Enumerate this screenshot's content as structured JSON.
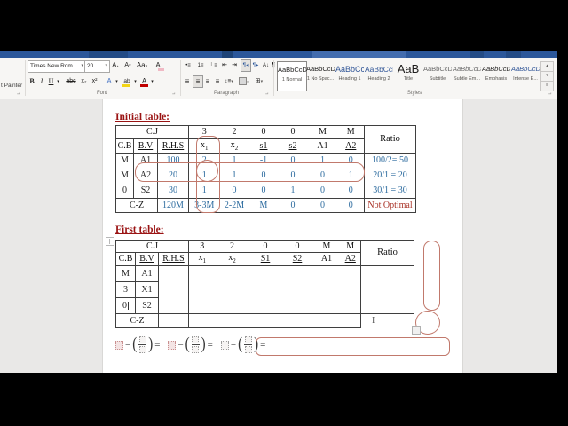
{
  "ribbon": {
    "clipboard": {
      "painter_label": "t Painter"
    },
    "font_group": {
      "label": "Font",
      "font_name": "Times New Rom",
      "font_size": "20"
    },
    "paragraph_group": {
      "label": "Paragraph"
    },
    "styles_group": {
      "label": "Styles",
      "items": [
        {
          "sample": "AaBbCcDd",
          "name": "1 Normal"
        },
        {
          "sample": "AaBbCcDd",
          "name": "1 No Spac..."
        },
        {
          "sample": "AaBbCc",
          "name": "Heading 1"
        },
        {
          "sample": "AaBbCcD",
          "name": "Heading 2"
        },
        {
          "sample": "AaB",
          "name": "Title"
        },
        {
          "sample": "AaBbCcD",
          "name": "Subtitle"
        },
        {
          "sample": "AaBbCcDd",
          "name": "Subtle Em..."
        },
        {
          "sample": "AaBbCcDd",
          "name": "Emphasis"
        },
        {
          "sample": "AaBbCcDd",
          "name": "Intense E..."
        }
      ]
    },
    "glyphs": {
      "caret": "▾",
      "caret_up": "▴",
      "launcher": "⌐",
      "bold": "B",
      "italic": "I",
      "underline": "U",
      "strike": "abc",
      "subscript": "x₂",
      "superscript": "x²",
      "grow": "A",
      "shrink": "A",
      "case": "Aa",
      "clear": "A",
      "effects": "A",
      "highlight": "ab",
      "fontcolor": "A",
      "bullets": "•≡",
      "numbering": "1≡",
      "multilevel": "⋮≡",
      "outdent": "⇤",
      "indent": "⇥",
      "rtl": "¶◂",
      "ltr": "¶▸",
      "sort": "A↓",
      "pilcrow": "¶",
      "align": "≡",
      "spacing": "↕≡",
      "borders": "⊞",
      "more": "≡"
    }
  },
  "doc": {
    "cursor": "I",
    "initial": {
      "heading": "Initial table:",
      "cj": "C.J",
      "ratio_label": "Ratio",
      "obj_row": [
        "3",
        "2",
        "0",
        "0",
        "M",
        "M"
      ],
      "cols": [
        "C.B",
        "B.V",
        "R.H.S"
      ],
      "var_cols": [
        {
          "t": "x",
          "s": "1"
        },
        {
          "t": "x",
          "s": "2"
        },
        {
          "t": "s1"
        },
        {
          "t": "s2"
        },
        {
          "t": "A1"
        },
        {
          "t": "A2"
        }
      ],
      "rows": [
        {
          "cb": "M",
          "bv": "A1",
          "rhs": "100",
          "v": [
            "2",
            "1",
            "-1",
            "0",
            "1",
            "0"
          ],
          "ratio": "100/2= 50"
        },
        {
          "cb": "M",
          "bv": "A2",
          "rhs": "20",
          "v": [
            "1",
            "1",
            "0",
            "0",
            "0",
            "1"
          ],
          "ratio": "20/1 = 20"
        },
        {
          "cb": "0",
          "bv": "S2",
          "rhs": "30",
          "v": [
            "1",
            "0",
            "0",
            "1",
            "0",
            "0"
          ],
          "ratio": "30/1 = 30"
        }
      ],
      "cz": {
        "label": "C-Z",
        "rhs": "120M",
        "v": [
          "3-3M",
          "2-2M",
          "M",
          "0",
          "0",
          "0"
        ],
        "status": "Not Optimal"
      }
    },
    "first": {
      "heading": "First table:",
      "cj": "C.J",
      "ratio_label": "Ratio",
      "obj_row": [
        "3",
        "2",
        "0",
        "0",
        "M",
        "M"
      ],
      "cols": [
        "C.B",
        "B.V",
        "R.H.S"
      ],
      "var_cols": [
        {
          "t": "x",
          "s": "1"
        },
        {
          "t": "x",
          "s": "2"
        },
        {
          "t": "S1"
        },
        {
          "t": "S2"
        },
        {
          "t": "A1"
        },
        {
          "t": "A2"
        }
      ],
      "rows": [
        {
          "cb": "M",
          "bv": "A1"
        },
        {
          "cb": "3",
          "bv": "X1"
        },
        {
          "cb": "0",
          "bv": "S2"
        }
      ],
      "cz": {
        "label": "C-Z"
      }
    },
    "equation": {
      "minus": "−",
      "equals": "=",
      "open": "(",
      "close": ")"
    }
  },
  "colors": {
    "titlebar_blue": "#2b579a",
    "value_blue": "#2b6a9e",
    "heading_red": "#9a1313",
    "status_red": "#a93226",
    "annotation_red": "#c1796c",
    "highlight_yellow": "#f3d516",
    "font_color_red": "#c00000"
  }
}
